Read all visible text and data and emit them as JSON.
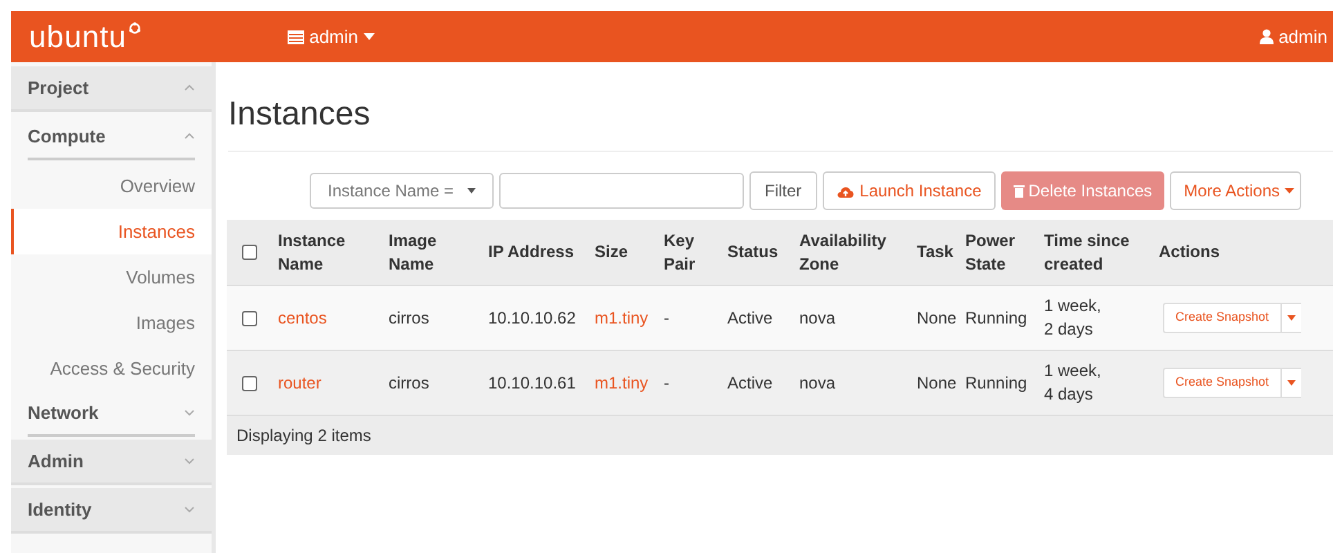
{
  "topbar": {
    "logo": "ubuntu",
    "project_menu": "admin",
    "user_menu": "admin"
  },
  "sidebar": [
    {
      "kind": "panel",
      "label": "Project",
      "expanded": true
    },
    {
      "kind": "group",
      "label": "Compute",
      "expanded": true
    },
    {
      "kind": "link",
      "label": "Overview",
      "selected": false
    },
    {
      "kind": "link",
      "label": "Instances",
      "selected": true
    },
    {
      "kind": "link",
      "label": "Volumes",
      "selected": false
    },
    {
      "kind": "link",
      "label": "Images",
      "selected": false
    },
    {
      "kind": "link",
      "label": "Access & Security",
      "selected": false
    },
    {
      "kind": "group",
      "label": "Network",
      "expanded": false
    },
    {
      "kind": "panel",
      "label": "Admin",
      "expanded": false
    },
    {
      "kind": "panel",
      "label": "Identity",
      "expanded": false
    }
  ],
  "page_title": "Instances",
  "toolbar": {
    "filter_select": "Instance Name =",
    "filter_button": "Filter",
    "launch_button": "Launch Instance",
    "delete_button": {
      "label": "Delete Instances",
      "disabled": true
    },
    "more_button": "More Actions"
  },
  "table": {
    "select_all_checked": false,
    "columns": [
      "Instance Name",
      "Image Name",
      "IP Address",
      "Size",
      "Key Pair",
      "Status",
      "Availability Zone",
      "Task",
      "Power State",
      "Time since created",
      "Actions"
    ],
    "rows": [
      {
        "checked": false,
        "cells": [
          "centos",
          "cirros",
          "10.10.10.62",
          "m1.tiny",
          "-",
          "Active",
          "nova",
          "None",
          "Running",
          "1 week, 2 days"
        ],
        "action": "Create Snapshot"
      },
      {
        "checked": false,
        "cells": [
          "router",
          "cirros",
          "10.10.10.61",
          "m1.tiny",
          "-",
          "Active",
          "nova",
          "None",
          "Running",
          "1 week, 4 days"
        ],
        "action": "Create Snapshot"
      }
    ],
    "footer": "Displaying 2 items"
  }
}
